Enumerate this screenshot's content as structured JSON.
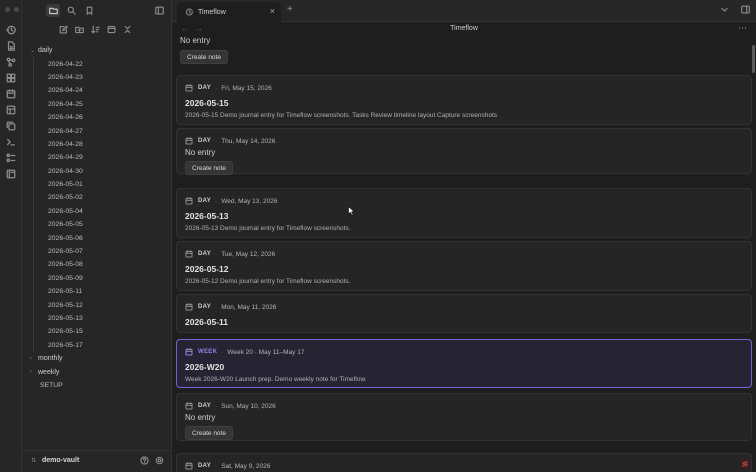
{
  "colors": {
    "accent": "#7b5fd0",
    "week_label": "#9b7fe8",
    "bg": "#1e1e1e",
    "sidebar_bg": "#262626"
  },
  "ribbon": {
    "icons": [
      "history-icon",
      "file-icon",
      "graph-icon",
      "blocks-icon",
      "calendar-icon",
      "template-icon",
      "copy-icon",
      "terminal-icon",
      "list-icon",
      "book-icon"
    ]
  },
  "sidebar": {
    "tree": {
      "open_folder": "daily",
      "daily_files": [
        "2026-04-22",
        "2026-04-23",
        "2026-04-24",
        "2026-04-25",
        "2026-04-26",
        "2026-04-27",
        "2026-04-28",
        "2026-04-29",
        "2026-04-30",
        "2026-05-01",
        "2026-05-02",
        "2026-05-04",
        "2026-05-05",
        "2026-05-06",
        "2026-05-07",
        "2026-05-08",
        "2026-05-09",
        "2026-05-11",
        "2026-05-12",
        "2026-05-13",
        "2026-05-15",
        "2026-05-17"
      ],
      "folders": [
        "monthly",
        "weekly"
      ],
      "root_file": "SETUP"
    },
    "vault_name": "demo-vault"
  },
  "tabbar": {
    "tab_title": "Timeflow"
  },
  "view": {
    "title": "Timeflow"
  },
  "timeline": {
    "top_fragment": {
      "empty_text": "No entry",
      "button": "Create note"
    },
    "cards": [
      {
        "kind": "DAY",
        "date": "Fri, May 15, 2026",
        "title": "2026-05-15",
        "desc": "2026-05-15 Demo journal entry for Timeflow screenshots. Tasks Review timeline layout Capture screenshots"
      },
      {
        "kind": "DAY",
        "date": "Thu, May 14, 2026",
        "empty_text": "No entry",
        "button": "Create note"
      },
      {
        "kind": "DAY",
        "date": "Wed, May 13, 2026",
        "title": "2026-05-13",
        "desc": "2026-05-13 Demo journal entry for Timeflow screenshots."
      },
      {
        "kind": "DAY",
        "date": "Tue, May 12, 2026",
        "title": "2026-05-12",
        "desc": "2026-05-12 Demo journal entry for Timeflow screenshots."
      },
      {
        "kind": "DAY",
        "date": "Mon, May 11, 2026",
        "title": "2026-05-11"
      },
      {
        "kind": "WEEK",
        "date": "Week 20 · May 11–May 17",
        "title": "2026-W20",
        "desc": "Week 2026-W20 Launch prep. Demo weekly note for Timeflow."
      },
      {
        "kind": "DAY",
        "date": "Sun, May 10, 2026",
        "empty_text": "No entry",
        "button": "Create note"
      },
      {
        "kind": "DAY",
        "date": "Sat, May 9, 2026"
      }
    ]
  }
}
